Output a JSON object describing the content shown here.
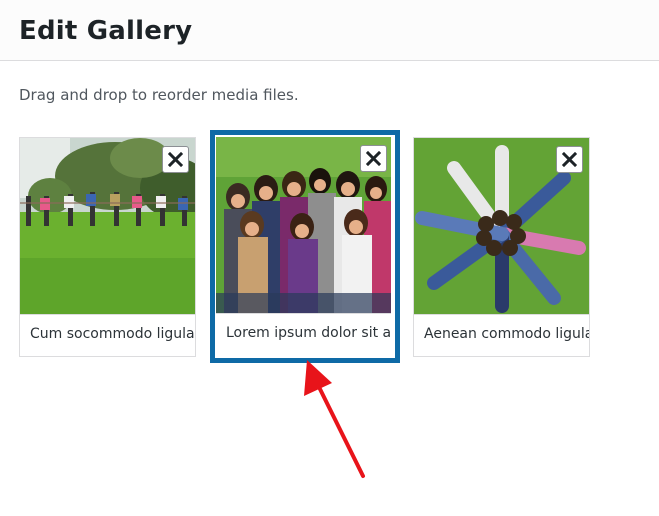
{
  "header": {
    "title": "Edit Gallery"
  },
  "instructions": "Drag and drop to reorder media files.",
  "gallery": {
    "items": [
      {
        "caption": "Cum socommodo ligula",
        "selected": false
      },
      {
        "caption": "Lorem ipsum dolor sit amet",
        "selected": true
      },
      {
        "caption": "Aenean commodo ligula",
        "selected": false
      }
    ]
  },
  "colors": {
    "selection_border": "#0e6aa6",
    "annotation_arrow": "#e8141a"
  }
}
